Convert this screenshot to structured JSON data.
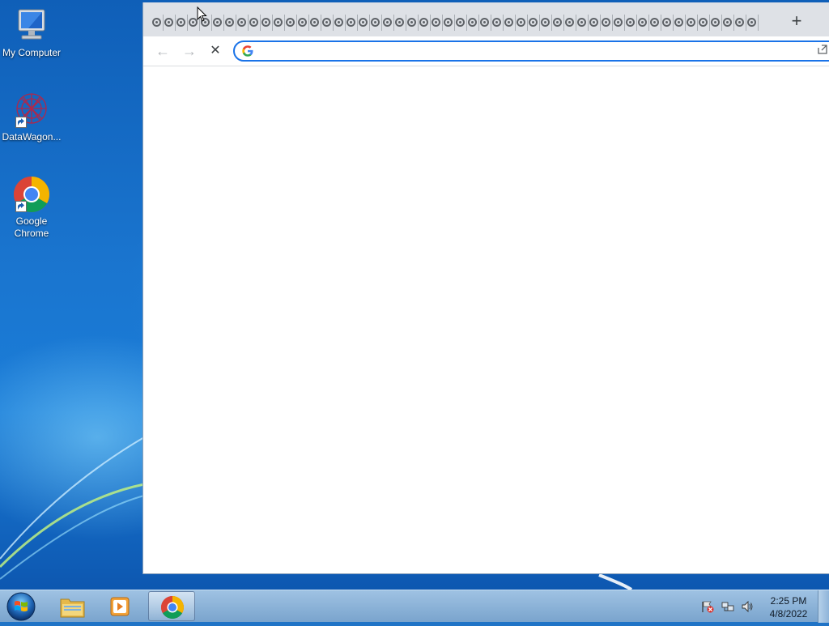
{
  "desktop": {
    "icons": [
      {
        "label": "My Computer",
        "icon": "computer-icon"
      },
      {
        "label": "DataWagon...",
        "icon": "datawagon-icon"
      },
      {
        "label": "Google Chrome",
        "icon": "chrome-icon"
      }
    ]
  },
  "browser": {
    "tab_count": 50,
    "tab_icon": "loading-ring-icon",
    "new_tab_label": "+",
    "toolbar": {
      "back_label": "←",
      "forward_label": "→",
      "stop_label": "✕"
    },
    "omnibox": {
      "value": "",
      "placeholder": ""
    },
    "accent_color": "#1a73e8"
  },
  "taskbar": {
    "items": [
      {
        "icon": "start-orb-icon"
      },
      {
        "icon": "file-explorer-icon"
      },
      {
        "icon": "media-player-icon"
      },
      {
        "icon": "chrome-icon",
        "active": true
      }
    ],
    "tray": {
      "icons": [
        "action-center-flag-icon",
        "network-icon",
        "volume-icon"
      ]
    },
    "clock": {
      "time": "2:25 PM",
      "date": "4/8/2022"
    }
  }
}
